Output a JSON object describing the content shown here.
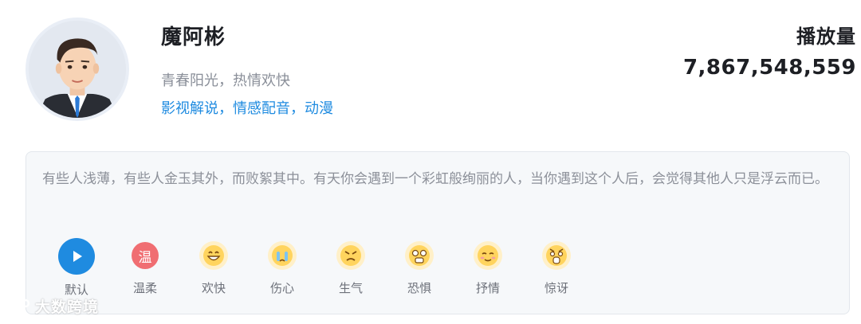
{
  "profile": {
    "name": "魔阿彬",
    "description": "青春阳光，热情欢快",
    "tags": "影视解说，情感配音，动漫"
  },
  "stats": {
    "plays_label": "播放量",
    "plays_value": "7,867,548,559"
  },
  "sample": {
    "text": "有些人浅薄，有些人金玉其外，而败絮其中。有天你会遇到一个彩虹般绚丽的人，当你遇到这个人后，会觉得其他人只是浮云而已。"
  },
  "emotions": [
    {
      "label": "默认",
      "icon": "play-icon"
    },
    {
      "label": "温柔",
      "icon": "warm-badge-icon",
      "badge_text": "温"
    },
    {
      "label": "欢快",
      "icon": "happy-face-icon"
    },
    {
      "label": "伤心",
      "icon": "sad-face-icon"
    },
    {
      "label": "生气",
      "icon": "angry-face-icon"
    },
    {
      "label": "恐惧",
      "icon": "fear-face-icon"
    },
    {
      "label": "抒情",
      "icon": "lyrical-face-icon"
    },
    {
      "label": "惊讶",
      "icon": "surprised-face-icon"
    }
  ],
  "watermark": {
    "text": "大数跨境"
  },
  "colors": {
    "accent": "#1f8be0",
    "warm_badge": "#f06e72",
    "emoji_bg": "#fff0c8"
  }
}
